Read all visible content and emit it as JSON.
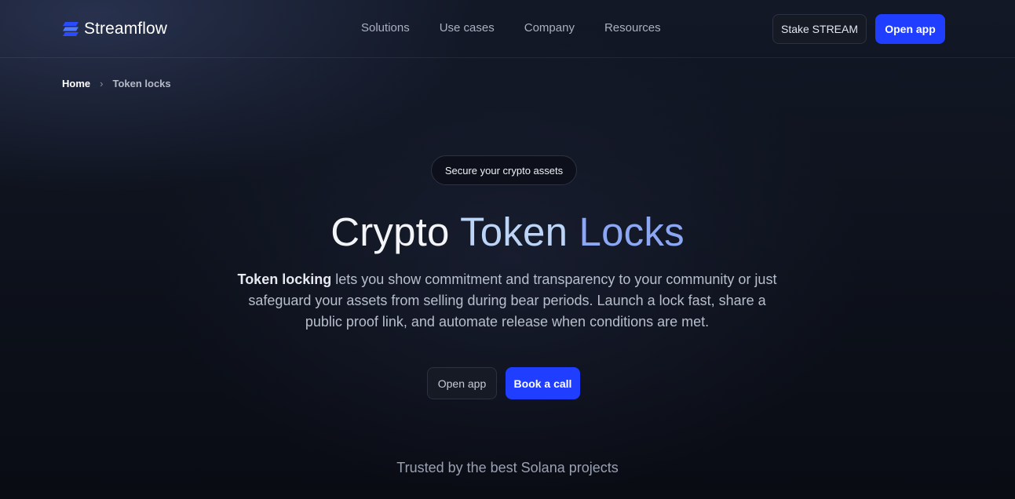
{
  "header": {
    "brand": "Streamflow",
    "nav": [
      "Solutions",
      "Use cases",
      "Company",
      "Resources"
    ],
    "stake_label": "Stake STREAM",
    "open_app_label": "Open app"
  },
  "breadcrumb": {
    "home": "Home",
    "separator": "›",
    "current": "Token locks"
  },
  "hero": {
    "pill": "Secure your crypto assets",
    "title_part1": "Crypto",
    "title_part2": "Token",
    "title_part3": "Locks",
    "desc_bold": "Token locking",
    "desc_rest": " lets you show commitment and transparency to your community or just safeguard your assets from selling during bear periods. Launch a lock fast, share a public proof link, and automate release when conditions are met.",
    "open_app_label": "Open app",
    "book_call_label": "Book a call"
  },
  "trusted": {
    "text": "Trusted by the best Solana projects"
  },
  "colors": {
    "accent": "#1f3eff",
    "title_gradient_mid": "#bcd4f5",
    "title_gradient_end": "#8ca8f5"
  },
  "icons": {
    "logo": "streamflow-logo-icon",
    "breadcrumb_separator": "chevron-right-icon"
  }
}
